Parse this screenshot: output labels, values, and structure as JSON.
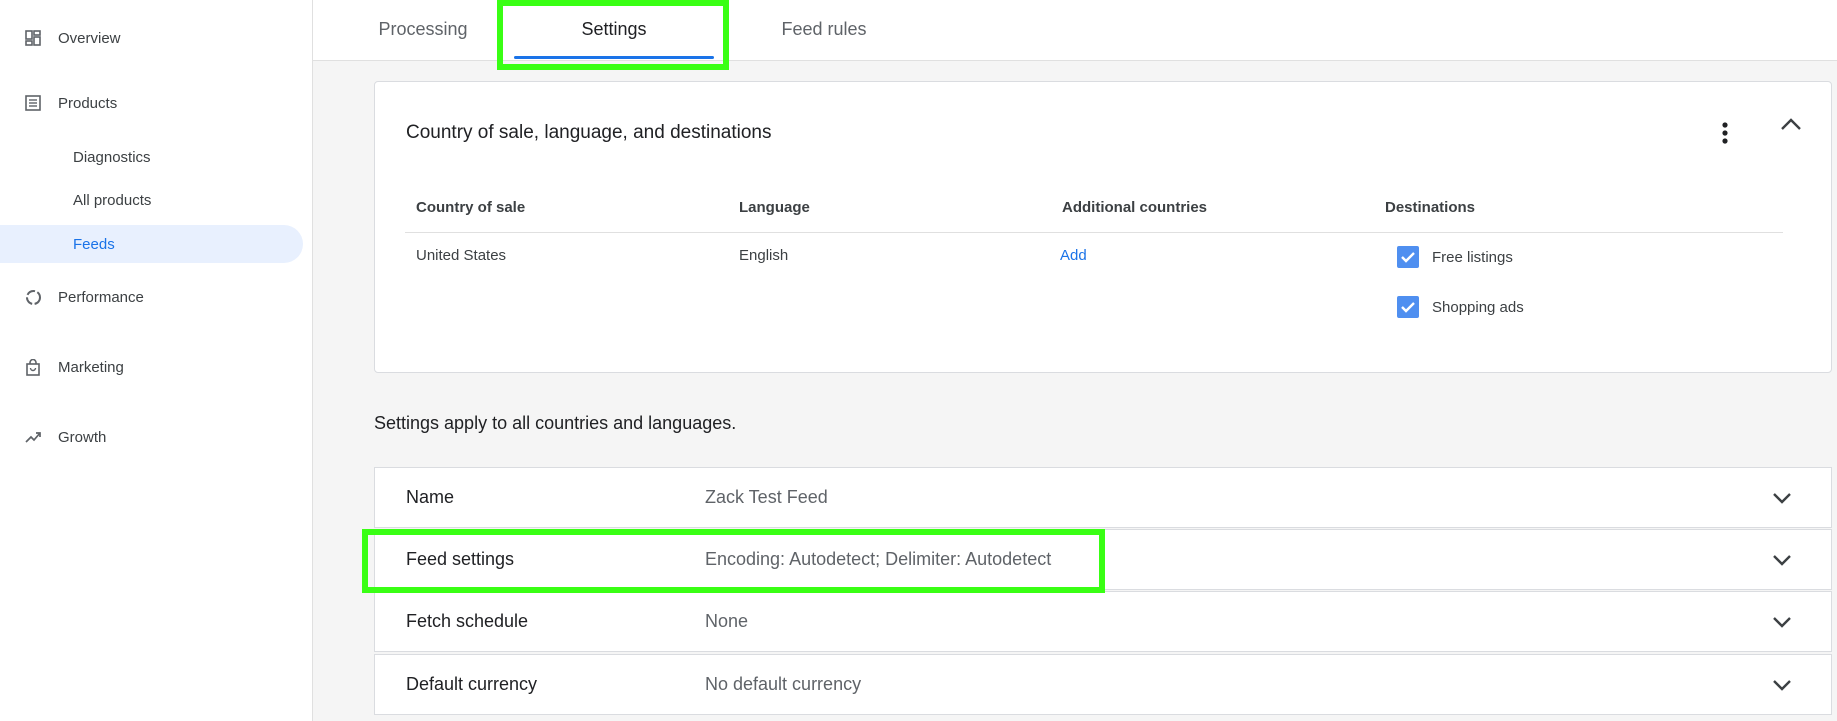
{
  "sidebar": {
    "items": [
      {
        "label": "Overview",
        "icon": "dashboard-icon"
      },
      {
        "label": "Products",
        "icon": "list-icon"
      },
      {
        "label": "Diagnostics"
      },
      {
        "label": "All products"
      },
      {
        "label": "Feeds"
      },
      {
        "label": "Performance",
        "icon": "donut-chart-icon"
      },
      {
        "label": "Marketing",
        "icon": "shopping-bag-icon"
      },
      {
        "label": "Growth",
        "icon": "trending-up-icon"
      }
    ]
  },
  "tabs": [
    {
      "label": "Processing"
    },
    {
      "label": "Settings"
    },
    {
      "label": "Feed rules"
    }
  ],
  "country_card": {
    "title": "Country of sale, language, and destinations",
    "headers": [
      "Country of sale",
      "Language",
      "Additional countries",
      "Destinations"
    ],
    "row": {
      "country": "United States",
      "language": "English",
      "additional": "Add",
      "destinations": [
        {
          "label": "Free listings",
          "checked": true
        },
        {
          "label": "Shopping ads",
          "checked": true
        }
      ]
    }
  },
  "settings_note": "Settings apply to all countries and languages.",
  "settings_rows": [
    {
      "label": "Name",
      "value": "Zack Test Feed"
    },
    {
      "label": "Feed settings",
      "value": "Encoding: Autodetect; Delimiter: Autodetect"
    },
    {
      "label": "Fetch schedule",
      "value": "None"
    },
    {
      "label": "Default currency",
      "value": "No default currency"
    }
  ],
  "colors": {
    "accent": "#1a73e8",
    "active_nav_bg": "#e8f0fe",
    "highlight": "#39ff14",
    "checkbox": "#4f8ff0"
  }
}
